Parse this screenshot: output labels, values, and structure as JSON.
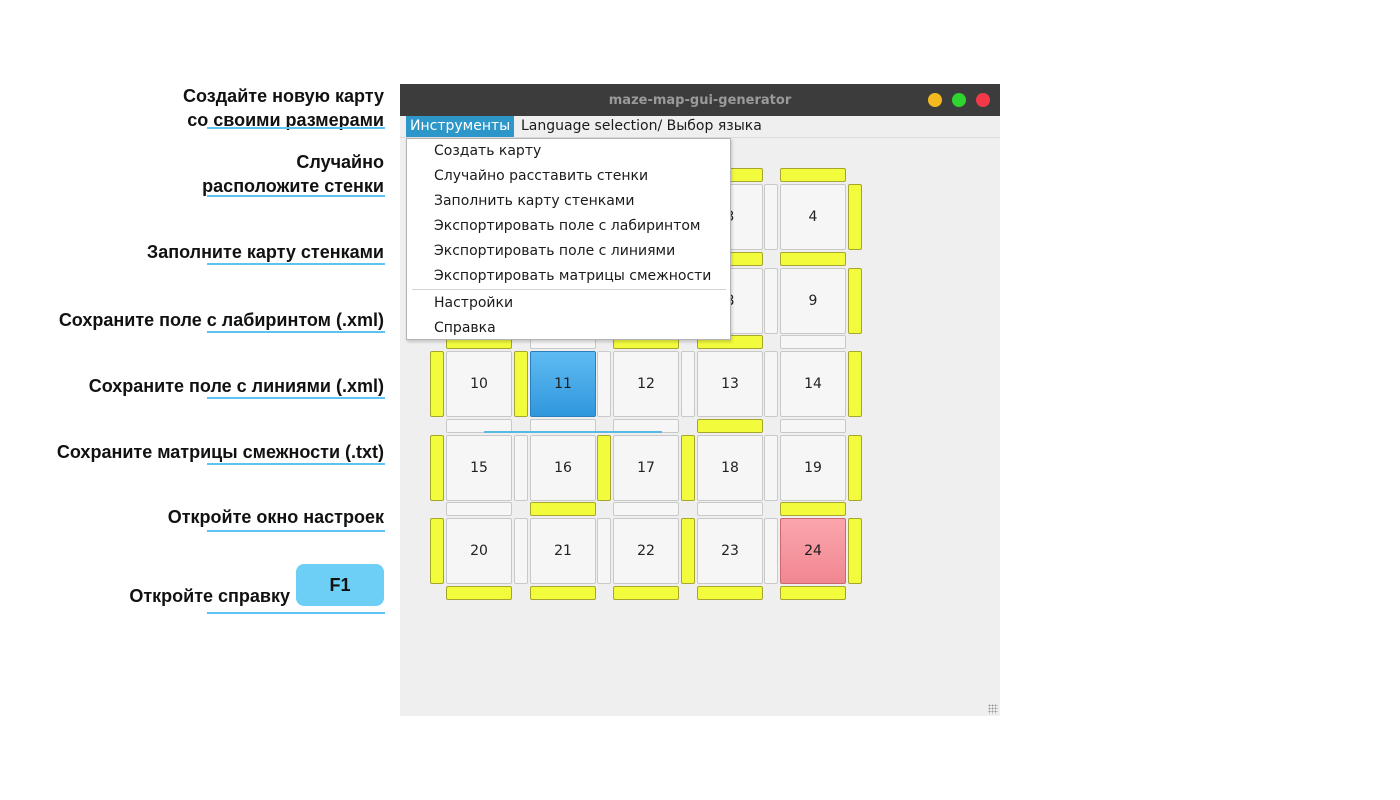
{
  "annotations": [
    {
      "id": "create",
      "lines": [
        "Создайте новую карту",
        "со своими размерами"
      ]
    },
    {
      "id": "random",
      "lines": [
        "Случайно",
        "расположите стенки"
      ]
    },
    {
      "id": "fill",
      "lines": [
        "Заполните карту стенками"
      ]
    },
    {
      "id": "save_maze",
      "lines": [
        "Сохраните поле с лабиринтом (.xml)"
      ]
    },
    {
      "id": "save_lines",
      "lines": [
        "Сохраните поле с линиями (.xml)"
      ]
    },
    {
      "id": "save_matrix",
      "lines": [
        "Сохраните матрицы смежности (.txt)"
      ]
    },
    {
      "id": "settings",
      "lines": [
        "Откройте окно настроек"
      ]
    },
    {
      "id": "help",
      "lines": [
        "Откройте справку"
      ]
    }
  ],
  "help_key": "F1",
  "window": {
    "title": "maze-map-gui-generator",
    "buttons": {
      "minimize_color": "#f4b91f",
      "maximize_color": "#2fd42f",
      "close_color": "#f2394a"
    }
  },
  "menubar": {
    "items": [
      {
        "label": "Инструменты",
        "active": true
      },
      {
        "label": "Language selection/ Выбор языка",
        "active": false
      }
    ]
  },
  "dropdown": {
    "items": [
      "Создать карту",
      "Случайно расставить стенки",
      "Заполнить карту стенками",
      "Экспортировать поле с лабиринтом",
      "Экспортировать поле с линиями",
      "Экспортировать матрицы смежности",
      "Настройки",
      "Справка"
    ]
  },
  "grid": {
    "cells": [
      {
        "label": "",
        "state": "normal"
      },
      {
        "label": "",
        "state": "normal"
      },
      {
        "label": "",
        "state": "normal"
      },
      {
        "label": "3",
        "state": "normal"
      },
      {
        "label": "4",
        "state": "normal"
      },
      {
        "label": "",
        "state": "normal"
      },
      {
        "label": "",
        "state": "normal"
      },
      {
        "label": "",
        "state": "normal"
      },
      {
        "label": "8",
        "state": "normal"
      },
      {
        "label": "9",
        "state": "normal"
      },
      {
        "label": "10",
        "state": "normal"
      },
      {
        "label": "11",
        "state": "start"
      },
      {
        "label": "12",
        "state": "normal"
      },
      {
        "label": "13",
        "state": "normal"
      },
      {
        "label": "14",
        "state": "normal"
      },
      {
        "label": "15",
        "state": "normal"
      },
      {
        "label": "16",
        "state": "normal"
      },
      {
        "label": "17",
        "state": "normal"
      },
      {
        "label": "18",
        "state": "normal"
      },
      {
        "label": "19",
        "state": "normal"
      },
      {
        "label": "20",
        "state": "normal"
      },
      {
        "label": "21",
        "state": "normal"
      },
      {
        "label": "22",
        "state": "normal"
      },
      {
        "label": "23",
        "state": "normal"
      },
      {
        "label": "24",
        "state": "finish"
      }
    ],
    "horizontal_walls": [
      [
        0,
        0,
        0,
        1,
        1
      ],
      [
        0,
        0,
        0,
        1,
        1
      ],
      [
        1,
        0,
        1,
        1,
        0
      ],
      [
        0,
        0,
        0,
        1,
        0
      ],
      [
        0,
        1,
        0,
        0,
        1
      ],
      [
        1,
        1,
        1,
        1,
        1
      ]
    ],
    "vertical_walls": [
      [
        0,
        0,
        0,
        0,
        0,
        1
      ],
      [
        0,
        0,
        0,
        0,
        0,
        1
      ],
      [
        1,
        1,
        0,
        0,
        0,
        1
      ],
      [
        1,
        0,
        1,
        1,
        0,
        1
      ],
      [
        1,
        0,
        0,
        1,
        0,
        1
      ]
    ]
  }
}
